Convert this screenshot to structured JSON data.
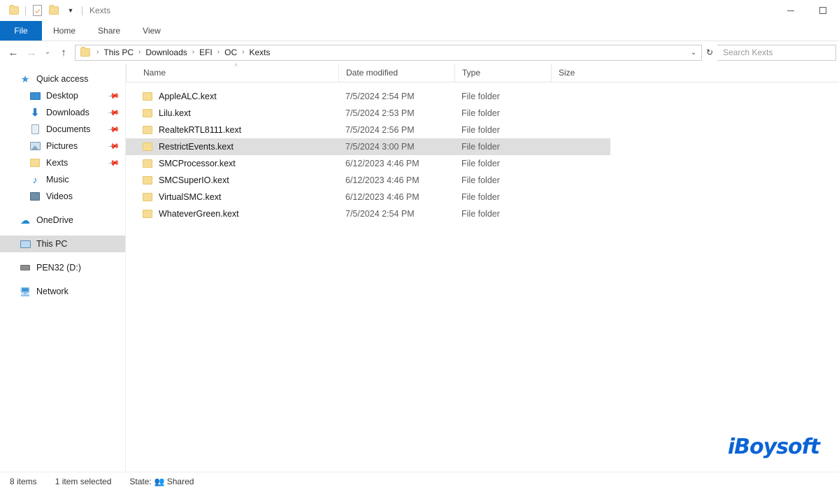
{
  "window": {
    "title": "Kexts",
    "quick_access_toolbar": [
      {
        "name": "folder-icon",
        "label": ""
      },
      {
        "name": "properties-icon",
        "label": ""
      },
      {
        "name": "new-folder-icon",
        "label": ""
      },
      {
        "name": "customize-qat-caret",
        "label": "▼"
      }
    ],
    "controls": {
      "minimize": "–",
      "maximize": "□"
    }
  },
  "ribbon": {
    "tabs": [
      {
        "label": "File",
        "active": true
      },
      {
        "label": "Home",
        "active": false
      },
      {
        "label": "Share",
        "active": false
      },
      {
        "label": "View",
        "active": false
      }
    ],
    "accent_color": "#0b6ec4"
  },
  "addressbar": {
    "back": "←",
    "forward": "→",
    "recent": "⌄",
    "up": "↑",
    "breadcrumbs": [
      "This PC",
      "Downloads",
      "EFI",
      "OC",
      "Kexts"
    ],
    "separator": "›",
    "dropdown_caret": "⌄",
    "refresh": "↻"
  },
  "search": {
    "placeholder": "Search Kexts",
    "value": ""
  },
  "sidebar": {
    "items": [
      {
        "label": "Quick access",
        "icon": "star-icon",
        "indent": false,
        "pinned": false,
        "selected": false
      },
      {
        "label": "Desktop",
        "icon": "desktop-icon",
        "indent": true,
        "pinned": true,
        "selected": false
      },
      {
        "label": "Downloads",
        "icon": "downloads-icon",
        "indent": true,
        "pinned": true,
        "selected": false
      },
      {
        "label": "Documents",
        "icon": "documents-icon",
        "indent": true,
        "pinned": true,
        "selected": false
      },
      {
        "label": "Pictures",
        "icon": "pictures-icon",
        "indent": true,
        "pinned": true,
        "selected": false
      },
      {
        "label": "Kexts",
        "icon": "folder-icon",
        "indent": true,
        "pinned": true,
        "selected": false
      },
      {
        "label": "Music",
        "icon": "music-icon",
        "indent": true,
        "pinned": false,
        "selected": false
      },
      {
        "label": "Videos",
        "icon": "videos-icon",
        "indent": true,
        "pinned": false,
        "selected": false
      },
      {
        "label": "OneDrive",
        "icon": "onedrive-icon",
        "indent": false,
        "pinned": false,
        "selected": false
      },
      {
        "label": "This PC",
        "icon": "this-pc-icon",
        "indent": false,
        "pinned": false,
        "selected": true
      },
      {
        "label": "PEN32 (D:)",
        "icon": "drive-icon",
        "indent": false,
        "pinned": false,
        "selected": false
      },
      {
        "label": "Network",
        "icon": "network-icon",
        "indent": false,
        "pinned": false,
        "selected": false
      }
    ],
    "pin_glyph": "📌"
  },
  "filelist": {
    "columns": [
      {
        "label": "Name",
        "key": "name"
      },
      {
        "label": "Date modified",
        "key": "date"
      },
      {
        "label": "Type",
        "key": "type"
      },
      {
        "label": "Size",
        "key": "size"
      }
    ],
    "sort_column": "Name",
    "sort_direction": "ascending",
    "sort_glyph": "˄",
    "rows": [
      {
        "name": "AppleALC.kext",
        "date": "7/5/2024 2:54 PM",
        "type": "File folder",
        "size": "",
        "selected": false
      },
      {
        "name": "Lilu.kext",
        "date": "7/5/2024 2:53 PM",
        "type": "File folder",
        "size": "",
        "selected": false
      },
      {
        "name": "RealtekRTL8111.kext",
        "date": "7/5/2024 2:56 PM",
        "type": "File folder",
        "size": "",
        "selected": false
      },
      {
        "name": "RestrictEvents.kext",
        "date": "7/5/2024 3:00 PM",
        "type": "File folder",
        "size": "",
        "selected": true
      },
      {
        "name": "SMCProcessor.kext",
        "date": "6/12/2023 4:46 PM",
        "type": "File folder",
        "size": "",
        "selected": false
      },
      {
        "name": "SMCSuperIO.kext",
        "date": "6/12/2023 4:46 PM",
        "type": "File folder",
        "size": "",
        "selected": false
      },
      {
        "name": "VirtualSMC.kext",
        "date": "6/12/2023 4:46 PM",
        "type": "File folder",
        "size": "",
        "selected": false
      },
      {
        "name": "WhateverGreen.kext",
        "date": "7/5/2024 2:54 PM",
        "type": "File folder",
        "size": "",
        "selected": false
      }
    ]
  },
  "statusbar": {
    "item_count": "8 items",
    "selection": "1 item selected",
    "state_label": "State:",
    "state_value": "Shared",
    "state_icon": "👥"
  },
  "watermark": {
    "text": "iBoysoft",
    "color": "#0b63d6"
  }
}
